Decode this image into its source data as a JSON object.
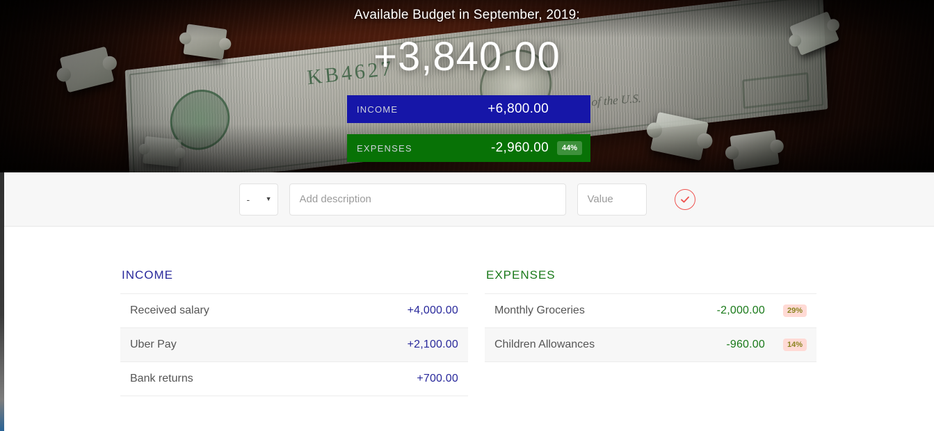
{
  "hero": {
    "title": "Available Budget in September, 2019:",
    "total_value": "+3,840.00",
    "income": {
      "label": "INCOME",
      "value": "+6,800.00",
      "percentage": "---"
    },
    "expenses": {
      "label": "EXPENSES",
      "value": "-2,960.00",
      "percentage": "44%"
    }
  },
  "add_form": {
    "type_selected": "-",
    "type_options": [
      "+",
      "-"
    ],
    "caret_icon": "chevron-down-icon",
    "description_placeholder": "Add description",
    "description_value": "",
    "value_placeholder": "Value",
    "value_value": "",
    "submit_icon": "check-circle-icon"
  },
  "income_list": {
    "title": "INCOME",
    "items": [
      {
        "description": "Received salary",
        "value": "+4,000.00"
      },
      {
        "description": "Uber Pay",
        "value": "+2,100.00"
      },
      {
        "description": "Bank returns",
        "value": "+700.00"
      }
    ]
  },
  "expenses_list": {
    "title": "EXPENSES",
    "items": [
      {
        "description": "Monthly Groceries",
        "value": "-2,000.00",
        "percentage": "29%"
      },
      {
        "description": "Children Allowances",
        "value": "-960.00",
        "percentage": "14%"
      }
    ]
  },
  "colors": {
    "income_blue": "#28289b",
    "income_bar": "#1616a8",
    "expenses_green": "#1a7a1a",
    "expenses_bar": "#087206",
    "accent_red": "#ef5350",
    "badge_bg": "#ffdad5",
    "bar_background": "#f7f7f7"
  }
}
